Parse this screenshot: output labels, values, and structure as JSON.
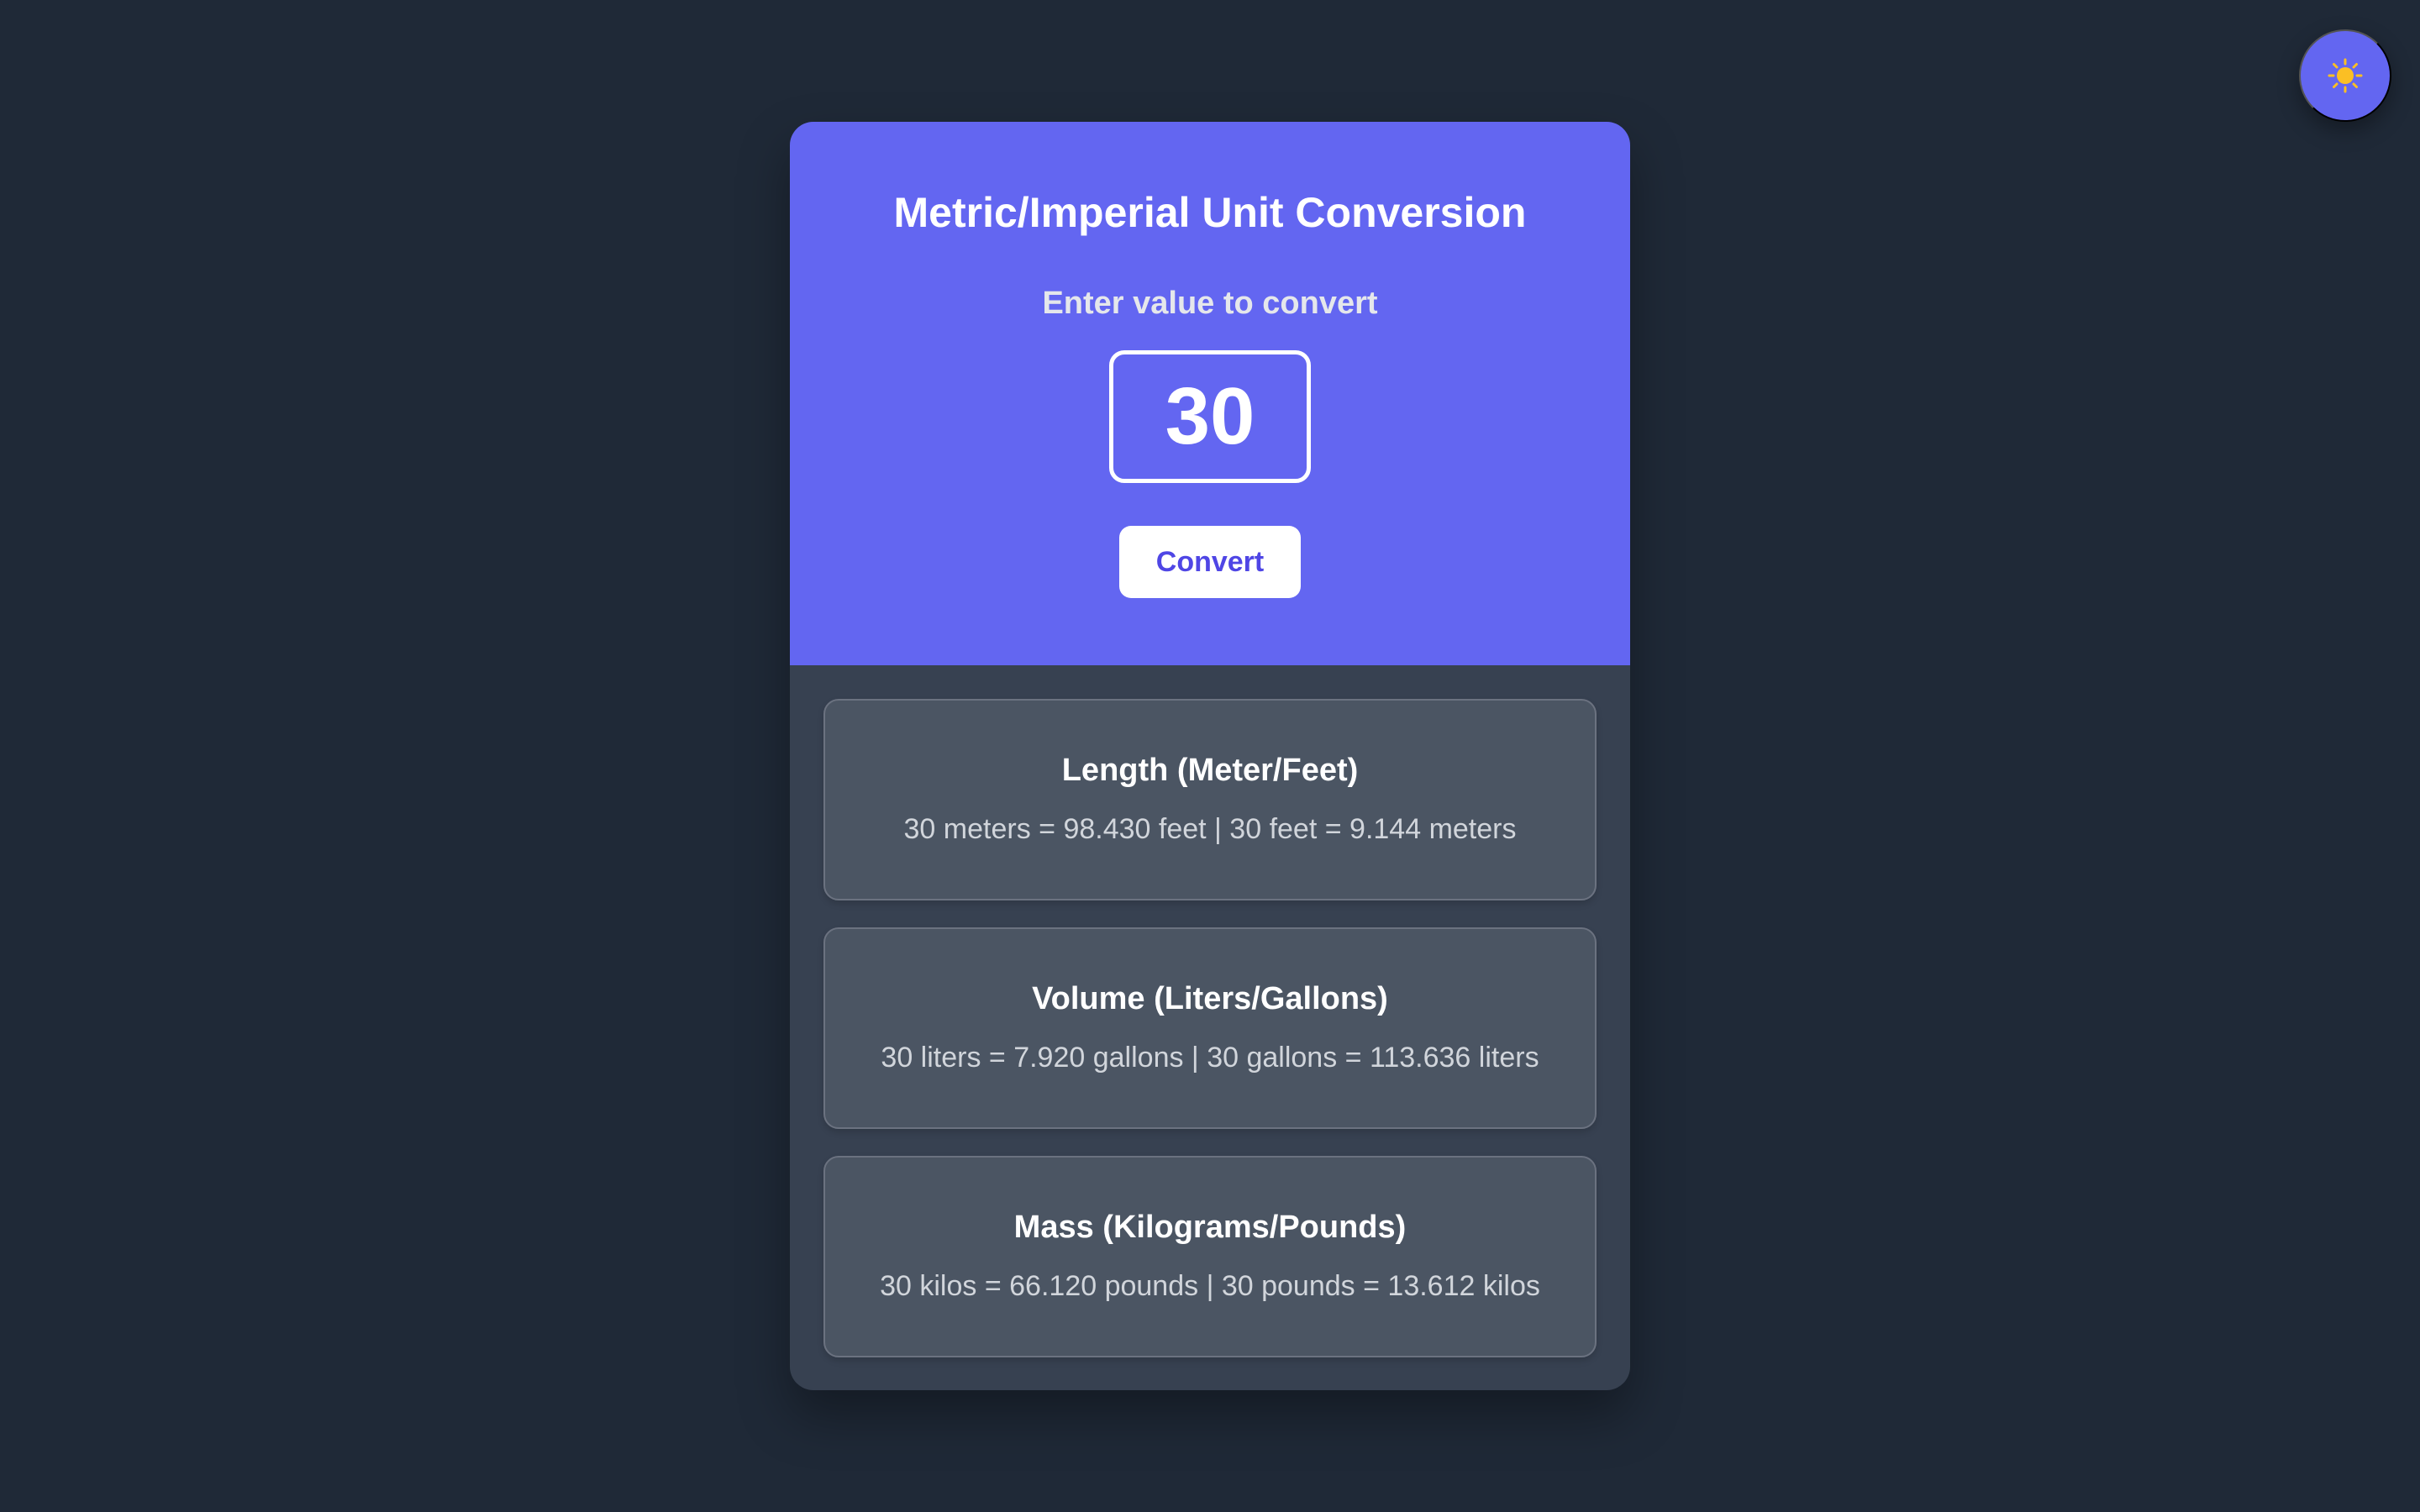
{
  "theme_toggle": {
    "icon": "sun-icon",
    "icon_color": "#fbbf24"
  },
  "converter": {
    "title": "Metric/Imperial Unit Conversion",
    "input_label": "Enter value to convert",
    "input_value": "30",
    "convert_label": "Convert"
  },
  "results": [
    {
      "title": "Length (Meter/Feet)",
      "text": "30 meters = 98.430 feet | 30 feet = 9.144 meters"
    },
    {
      "title": "Volume (Liters/Gallons)",
      "text": "30 liters = 7.920 gallons | 30 gallons = 113.636 liters"
    },
    {
      "title": "Mass (Kilograms/Pounds)",
      "text": "30 kilos = 66.120 pounds | 30 pounds = 13.612 kilos"
    }
  ],
  "colors": {
    "page_background": "#1f2937",
    "card_background": "#374151",
    "accent": "#6366f1",
    "result_background": "#4b5563",
    "button_text": "#4f46e5"
  }
}
